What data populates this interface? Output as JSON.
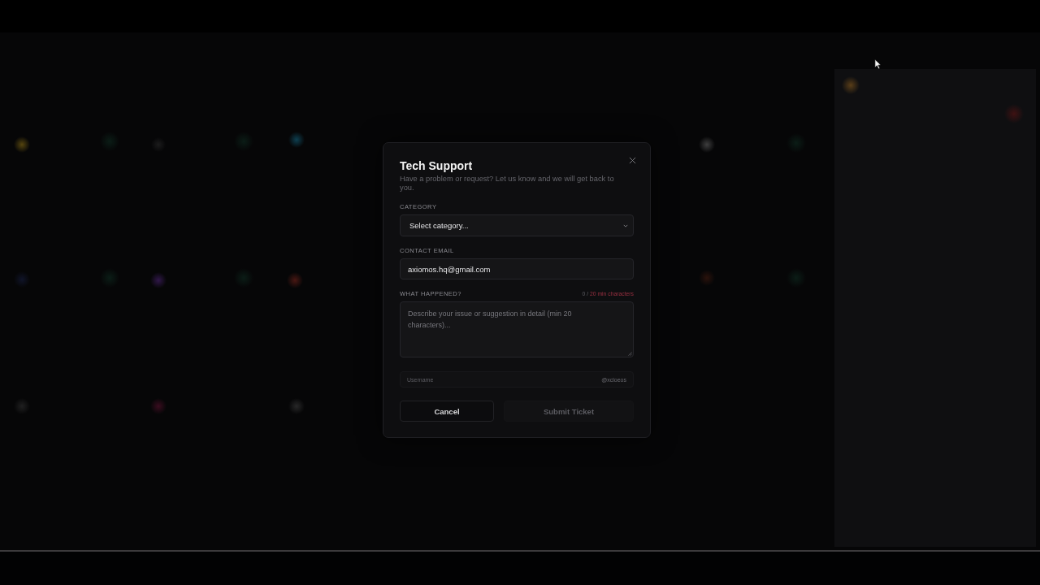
{
  "dialog": {
    "title": "Tech Support",
    "subtitle": "Have a problem or request? Let us know and we will get back to you."
  },
  "fields": [
    {
      "kind": "select",
      "label": "CATEGORY",
      "value": "Select category..."
    },
    {
      "kind": "text",
      "label": "CONTACT EMAIL",
      "value": "axiomos.hq@gmail.com"
    },
    {
      "kind": "textarea",
      "label": "WHAT HAPPENED?",
      "counter": {
        "count": "0 /",
        "requirement": "20 min characters",
        "met": false
      },
      "placeholder": "Describe your issue or suggestion in detail (min 20 characters)..."
    },
    {
      "kind": "handle",
      "placeholder": "Username",
      "suffix": "@xcloeos",
      "disabled": true
    }
  ],
  "buttons": [
    {
      "label": "Cancel",
      "disabled": false
    },
    {
      "label": "Submit Ticket",
      "disabled": true
    }
  ]
}
